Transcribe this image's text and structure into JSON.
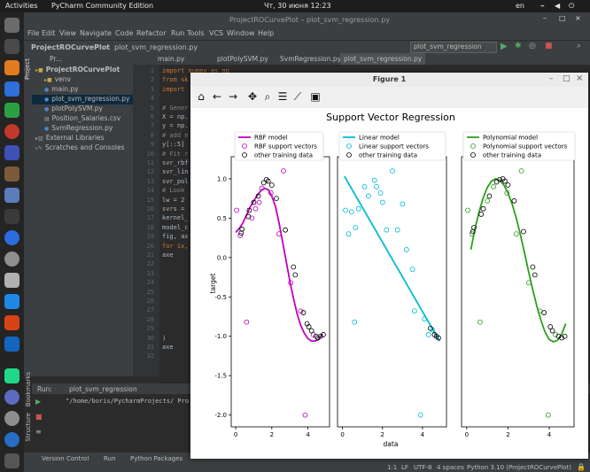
{
  "topbar": {
    "activities": "Activities",
    "app": "PyCharm Community Edition",
    "clock": "Чт, 30 июня 12:23",
    "lang": "en"
  },
  "pycharm": {
    "window_title": "ProjectROCurvePlot – plot_svm_regression.py",
    "menu": [
      "File",
      "Edit",
      "View",
      "Navigate",
      "Code",
      "Refactor",
      "Run",
      "Tools",
      "VCS",
      "Window",
      "Help"
    ],
    "breadcrumb_project": "ProjectROCurvePlot",
    "breadcrumb_file": "plot_svm_regression.py",
    "run_config": "plot_svm_regression",
    "project_label": "Pr...",
    "tree": [
      {
        "label": "ProjectROCurvePlot",
        "indent": 0,
        "kind": "folder"
      },
      {
        "label": "venv",
        "indent": 1,
        "kind": "folder"
      },
      {
        "label": "main.py",
        "indent": 1,
        "kind": "py"
      },
      {
        "label": "plot_svm_regression.py",
        "indent": 1,
        "kind": "py",
        "selected": true
      },
      {
        "label": "plotPolySVM.py",
        "indent": 1,
        "kind": "py"
      },
      {
        "label": "Position_Salaries.csv",
        "indent": 1,
        "kind": "csv"
      },
      {
        "label": "SvmRegression.py",
        "indent": 1,
        "kind": "py"
      },
      {
        "label": "External Libraries",
        "indent": 0,
        "kind": "lib"
      },
      {
        "label": "Scratches and Consoles",
        "indent": 0,
        "kind": "scratch"
      }
    ],
    "tabs": [
      "main.py",
      "plotPolySVM.py",
      "SvmRegression.py",
      "plot_svm_regression.py"
    ],
    "code_lines": [
      {
        "n": "1",
        "text": "import numpy as np"
      },
      {
        "n": "2",
        "text": "from sk"
      },
      {
        "n": "3",
        "text": "import"
      },
      {
        "n": "4",
        "text": ""
      },
      {
        "n": "5",
        "text": "# Gener"
      },
      {
        "n": "6",
        "text": "X = np."
      },
      {
        "n": "7",
        "text": "y = np."
      },
      {
        "n": "8",
        "text": "# add n"
      },
      {
        "n": "9",
        "text": "y[::5]"
      },
      {
        "n": "10",
        "text": "# Fit r"
      },
      {
        "n": "11",
        "text": "svr_rbf"
      },
      {
        "n": "12",
        "text": "svr_lin"
      },
      {
        "n": "13",
        "text": "svr_pol"
      },
      {
        "n": "14",
        "text": "# Look"
      },
      {
        "n": "15",
        "text": "lw = 2"
      },
      {
        "n": "16",
        "text": "svrs ="
      },
      {
        "n": "17",
        "text": "kernel_"
      },
      {
        "n": "18",
        "text": "model_c"
      },
      {
        "n": "19",
        "text": "fig, ax"
      },
      {
        "n": "20",
        "text": "for ix,"
      },
      {
        "n": "21",
        "text": "    axe"
      },
      {
        "n": "22",
        "text": ""
      },
      {
        "n": "23",
        "text": ""
      },
      {
        "n": "24",
        "text": ""
      },
      {
        "n": "25",
        "text": ""
      },
      {
        "n": "26",
        "text": ""
      },
      {
        "n": "27",
        "text": ""
      },
      {
        "n": "28",
        "text": ""
      },
      {
        "n": "29",
        "text": ""
      },
      {
        "n": "30",
        "text": "    )"
      },
      {
        "n": "31",
        "text": "    axe"
      },
      {
        "n": "32",
        "text": ""
      }
    ],
    "run_label": "Run:",
    "run_tab": "plot_svm_regression",
    "run_output": "\"/home/boris/PycharmProjects/ Pro",
    "side_labels": [
      "Project",
      "Bookmarks",
      "Structure"
    ],
    "bottom_tabs": [
      "Version Control",
      "Run",
      "Python Packages"
    ],
    "status": {
      "pos": "1:1",
      "lf": "LF",
      "enc": "UTF-8",
      "indent": "4 spaces",
      "interp": "Python 3.10 (ProjectROCurvePlot)"
    }
  },
  "figure": {
    "title": "Figure 1",
    "suptitle": "Support Vector Regression",
    "ylabel": "target",
    "xlabel": "data",
    "toolbar_icons": [
      "home-icon",
      "back-icon",
      "forward-icon",
      "pan-icon",
      "zoom-icon",
      "configure-icon",
      "axes-icon",
      "save-icon"
    ]
  },
  "chart_data": [
    {
      "type": "scatter",
      "title": "",
      "xlabel": "",
      "ylabel": "target",
      "xlim": [
        -0.25,
        5.2
      ],
      "ylim": [
        -2.15,
        1.28
      ],
      "xticks": [
        0,
        2,
        4
      ],
      "yticks": [
        1.0,
        0.5,
        0.0,
        -0.5,
        -1.0,
        -1.5,
        -2.0
      ],
      "legend_position": "top",
      "series": [
        {
          "name": "RBF model",
          "kind": "line",
          "color": "#c000c0",
          "x": [
            0.0,
            0.2,
            0.4,
            0.6,
            0.8,
            1.0,
            1.2,
            1.4,
            1.6,
            1.8,
            2.0,
            2.2,
            2.4,
            2.6,
            2.8,
            3.0,
            3.2,
            3.4,
            3.6,
            3.8,
            4.0,
            4.2,
            4.4,
            4.6,
            4.8
          ],
          "y": [
            0.32,
            0.37,
            0.44,
            0.54,
            0.64,
            0.72,
            0.79,
            0.85,
            0.88,
            0.86,
            0.78,
            0.65,
            0.44,
            0.2,
            -0.05,
            -0.3,
            -0.52,
            -0.71,
            -0.86,
            -0.96,
            -1.03,
            -1.06,
            -1.06,
            -1.04,
            -0.97
          ]
        },
        {
          "name": "RBF support vectors",
          "kind": "points",
          "color": "#c000c0",
          "x": [
            0.05,
            0.25,
            0.6,
            0.9,
            1.1,
            1.3,
            1.45,
            1.95,
            2.4,
            2.65,
            3.05,
            3.6,
            3.85,
            4.3
          ],
          "y": [
            0.6,
            0.28,
            -0.82,
            0.5,
            0.62,
            0.7,
            0.88,
            0.82,
            0.3,
            1.1,
            -0.32,
            -0.68,
            -2.0,
            -0.98
          ]
        },
        {
          "name": "other training data",
          "kind": "points",
          "color": "#000000",
          "x": [
            0.3,
            0.35,
            0.7,
            0.75,
            1.0,
            1.25,
            1.55,
            1.7,
            1.8,
            2.0,
            2.25,
            2.75,
            3.2,
            3.3,
            3.75,
            3.95,
            4.05,
            4.2,
            4.45,
            4.55,
            4.7,
            4.85
          ],
          "y": [
            0.31,
            0.36,
            0.52,
            0.6,
            0.7,
            0.78,
            0.95,
            0.99,
            0.97,
            0.92,
            0.75,
            0.35,
            -0.12,
            -0.22,
            -0.7,
            -0.84,
            -0.88,
            -0.93,
            -1.0,
            -1.02,
            -1.0,
            -0.98
          ]
        }
      ]
    },
    {
      "type": "scatter",
      "title": "",
      "xlabel": "data",
      "ylabel": "",
      "xlim": [
        -0.25,
        5.2
      ],
      "ylim": [
        -2.15,
        1.28
      ],
      "xticks": [
        0,
        2,
        4
      ],
      "yticks": [],
      "legend_position": "top",
      "series": [
        {
          "name": "Linear model",
          "kind": "line",
          "color": "#00bcd4",
          "x": [
            0.1,
            4.85
          ],
          "y": [
            1.03,
            -1.06
          ]
        },
        {
          "name": "Linear support vectors",
          "kind": "points",
          "color": "#00bcd4",
          "x": [
            0.15,
            0.3,
            0.45,
            0.6,
            0.65,
            0.8,
            1.1,
            1.3,
            1.6,
            1.7,
            1.9,
            2.0,
            2.2,
            2.5,
            2.75,
            3.0,
            3.2,
            3.5,
            3.6,
            3.9,
            4.1,
            4.3,
            4.5
          ],
          "y": [
            0.6,
            0.3,
            0.58,
            -0.82,
            0.38,
            0.62,
            0.9,
            0.78,
            0.98,
            0.9,
            0.82,
            0.7,
            0.35,
            1.1,
            0.35,
            0.68,
            0.1,
            -0.15,
            -0.68,
            -2.0,
            -0.78,
            -0.98,
            -0.92
          ]
        },
        {
          "name": "other training data",
          "kind": "points",
          "color": "#000000",
          "x": [
            4.4,
            4.6,
            4.7,
            4.8
          ],
          "y": [
            -0.9,
            -0.98,
            -1.0,
            -1.02
          ]
        }
      ]
    },
    {
      "type": "scatter",
      "title": "",
      "xlabel": "",
      "ylabel": "",
      "xlim": [
        -0.25,
        5.2
      ],
      "ylim": [
        -2.15,
        1.28
      ],
      "xticks": [
        0,
        2,
        4
      ],
      "yticks": [],
      "legend_position": "top",
      "series": [
        {
          "name": "Polynomial model",
          "kind": "line",
          "color": "#2e9e1e",
          "x": [
            0.2,
            0.4,
            0.6,
            0.8,
            1.0,
            1.2,
            1.4,
            1.6,
            1.8,
            2.0,
            2.2,
            2.4,
            2.6,
            2.8,
            3.0,
            3.2,
            3.4,
            3.6,
            3.8,
            4.0,
            4.2,
            4.4,
            4.6,
            4.8
          ],
          "y": [
            0.1,
            0.36,
            0.58,
            0.76,
            0.89,
            0.97,
            1.0,
            0.98,
            0.92,
            0.82,
            0.68,
            0.5,
            0.29,
            0.06,
            -0.18,
            -0.41,
            -0.62,
            -0.8,
            -0.95,
            -1.04,
            -1.07,
            -1.05,
            -0.97,
            -0.84
          ]
        },
        {
          "name": "Polynomial support vectors",
          "kind": "points",
          "color": "#2e9e1e",
          "x": [
            0.05,
            0.25,
            0.65,
            1.0,
            1.3,
            1.95,
            2.4,
            2.65,
            3.0,
            3.55,
            3.95,
            4.3
          ],
          "y": [
            0.6,
            0.3,
            -0.82,
            0.72,
            0.9,
            0.82,
            0.3,
            1.1,
            -0.32,
            -0.68,
            -2.0,
            -0.98
          ]
        },
        {
          "name": "other training data",
          "kind": "points",
          "color": "#000000",
          "x": [
            0.3,
            0.35,
            0.7,
            0.8,
            1.1,
            1.45,
            1.6,
            1.75,
            1.85,
            2.0,
            2.3,
            2.75,
            3.2,
            3.3,
            3.75,
            4.05,
            4.15,
            4.45,
            4.6,
            4.75
          ],
          "y": [
            0.33,
            0.38,
            0.55,
            0.62,
            0.78,
            0.96,
            0.99,
            1.0,
            0.97,
            0.92,
            0.72,
            0.33,
            -0.12,
            -0.22,
            -0.7,
            -0.88,
            -0.93,
            -1.0,
            -1.02,
            -1.0
          ]
        }
      ]
    }
  ]
}
